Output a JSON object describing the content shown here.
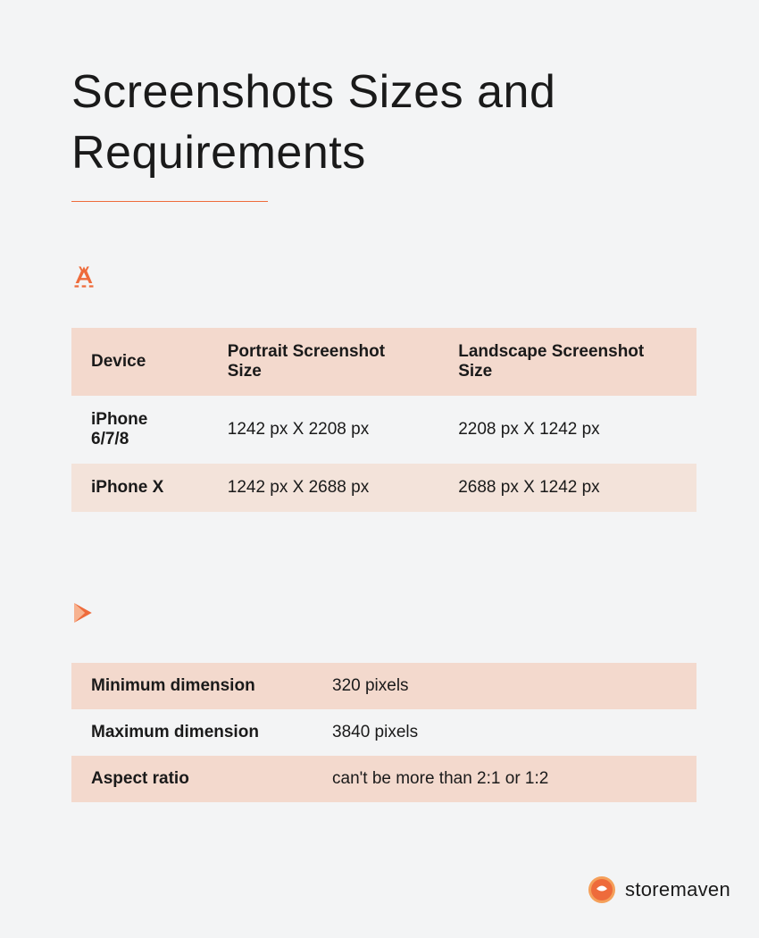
{
  "title": "Screenshots Sizes and Requirements",
  "appstore_table": {
    "headers": [
      "Device",
      "Portrait Screenshot Size",
      "Landscape Screenshot Size"
    ],
    "rows": [
      {
        "device": "iPhone 6/7/8",
        "portrait": "1242 px X 2208 px",
        "landscape": "2208 px X 1242 px"
      },
      {
        "device": "iPhone X",
        "portrait": "1242 px X 2688 px",
        "landscape": "2688 px X 1242 px"
      }
    ]
  },
  "playstore_specs": {
    "rows": [
      {
        "key": "Minimum dimension",
        "value": " 320 pixels"
      },
      {
        "key": "Maximum dimension",
        "value": "3840 pixels"
      },
      {
        "key": "Aspect ratio",
        "value": "can't be more than 2:1 or 1:2"
      }
    ]
  },
  "brand": "storemaven",
  "colors": {
    "accent": "#ee6b3b",
    "tint_dark": "#f3d9cd",
    "tint_light": "#f3e3da"
  }
}
